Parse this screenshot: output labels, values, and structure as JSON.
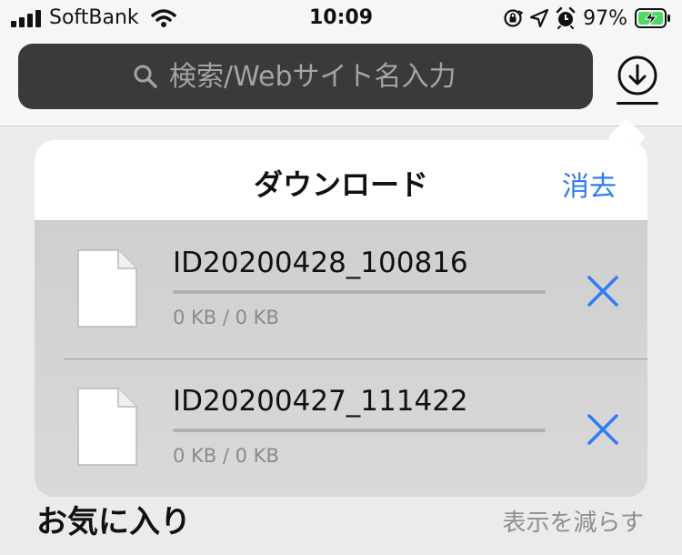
{
  "status_bar": {
    "carrier": "SoftBank",
    "time": "10:09",
    "battery_percent": "97%",
    "icons": [
      "signal-icon",
      "wifi-icon",
      "orientation-lock-icon",
      "location-icon",
      "alarm-icon",
      "battery-charging-icon"
    ]
  },
  "search": {
    "placeholder": "検索/Webサイト名入力",
    "value": ""
  },
  "downloads_popover": {
    "title": "ダウンロード",
    "clear_label": "消去",
    "items": [
      {
        "name": "ID20200428_100816",
        "size": "0 KB / 0 KB",
        "progress": 0
      },
      {
        "name": "ID20200427_111422",
        "size": "0 KB / 0 KB",
        "progress": 0
      }
    ]
  },
  "favorites": {
    "title": "お気に入り",
    "toggle_label": "表示を減らす"
  },
  "colors": {
    "accent": "#2f7cf6",
    "battery_green": "#4cd964",
    "search_bg": "#3a3a3c"
  }
}
